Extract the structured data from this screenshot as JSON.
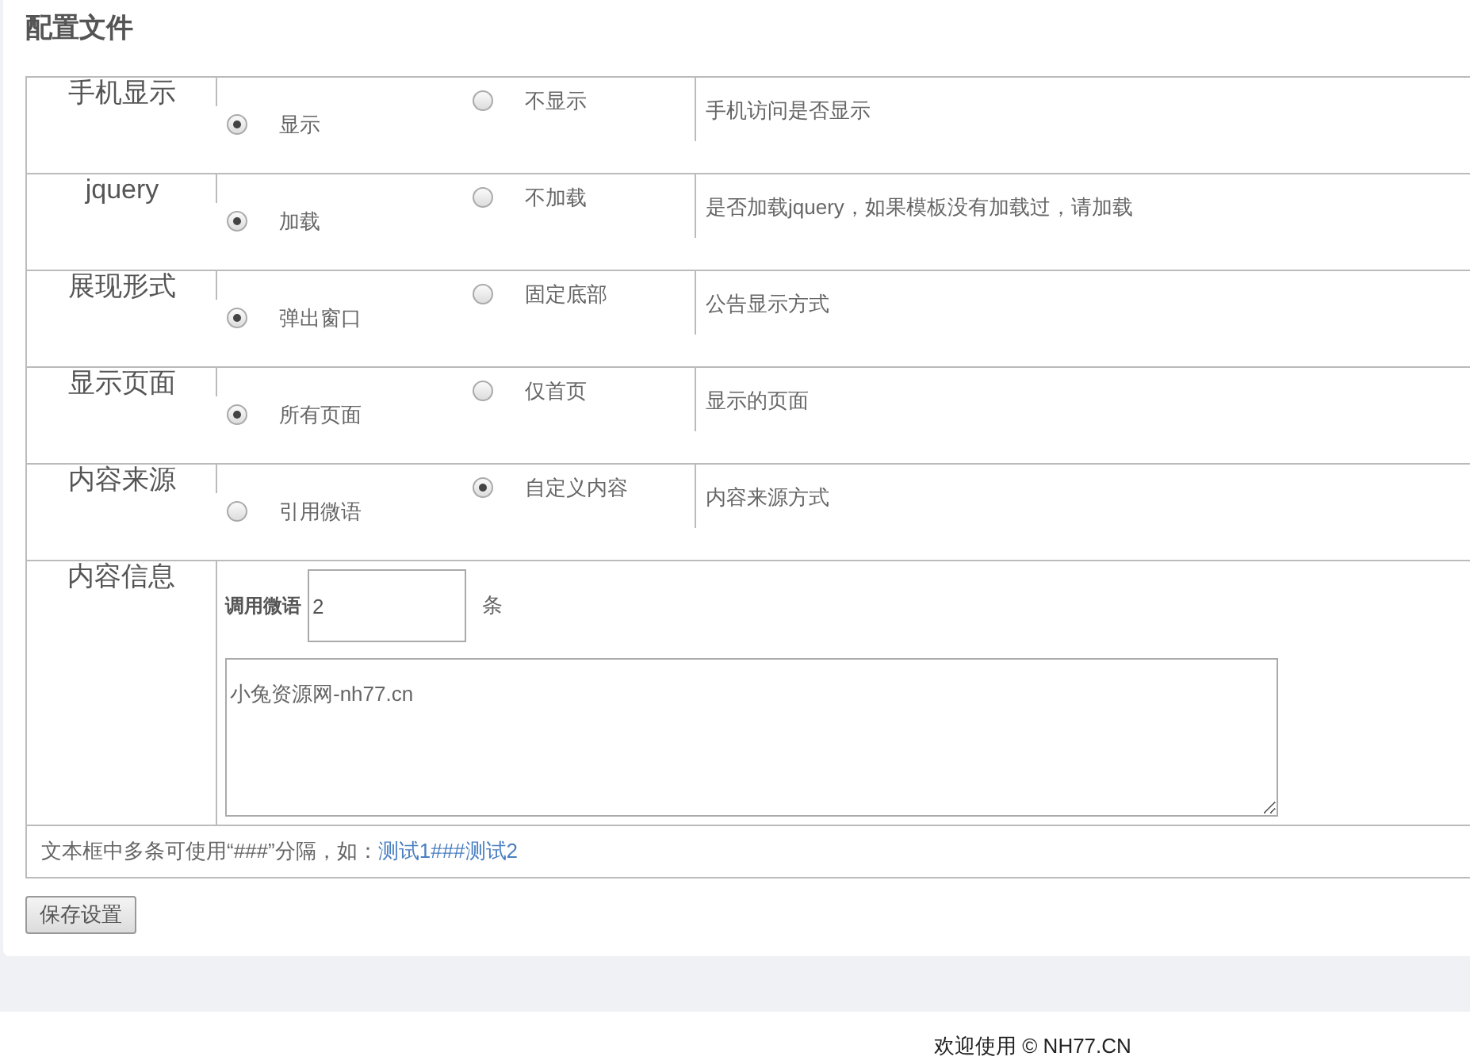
{
  "title": "配置文件",
  "settings": [
    {
      "label": "手机显示",
      "options": [
        {
          "label": "显示",
          "selected": true
        },
        {
          "label": "不显示",
          "selected": false
        }
      ],
      "description": "手机访问是否显示"
    },
    {
      "label": "jquery",
      "options": [
        {
          "label": "加载",
          "selected": true
        },
        {
          "label": "不加载",
          "selected": false
        }
      ],
      "description": "是否加载jquery，如果模板没有加载过，请加载"
    },
    {
      "label": "展现形式",
      "options": [
        {
          "label": "弹出窗口",
          "selected": true
        },
        {
          "label": "固定底部",
          "selected": false
        }
      ],
      "description": "公告显示方式"
    },
    {
      "label": "显示页面",
      "options": [
        {
          "label": "所有页面",
          "selected": true
        },
        {
          "label": "仅首页",
          "selected": false
        }
      ],
      "description": "显示的页面"
    },
    {
      "label": "内容来源",
      "options": [
        {
          "label": "引用微语",
          "selected": false
        },
        {
          "label": "自定义内容",
          "selected": true
        }
      ],
      "description": "内容来源方式"
    }
  ],
  "content_info": {
    "label": "内容信息",
    "count_label": "调用微语",
    "count_value": "2",
    "count_unit": "条",
    "custom_text": "小兔资源网-nh77.cn"
  },
  "hint": {
    "text": "文本框中多条可使用“###”分隔，如：",
    "example": "测试1###测试2"
  },
  "save_button": "保存设置",
  "footer": "欢迎使用 © NH77.CN"
}
